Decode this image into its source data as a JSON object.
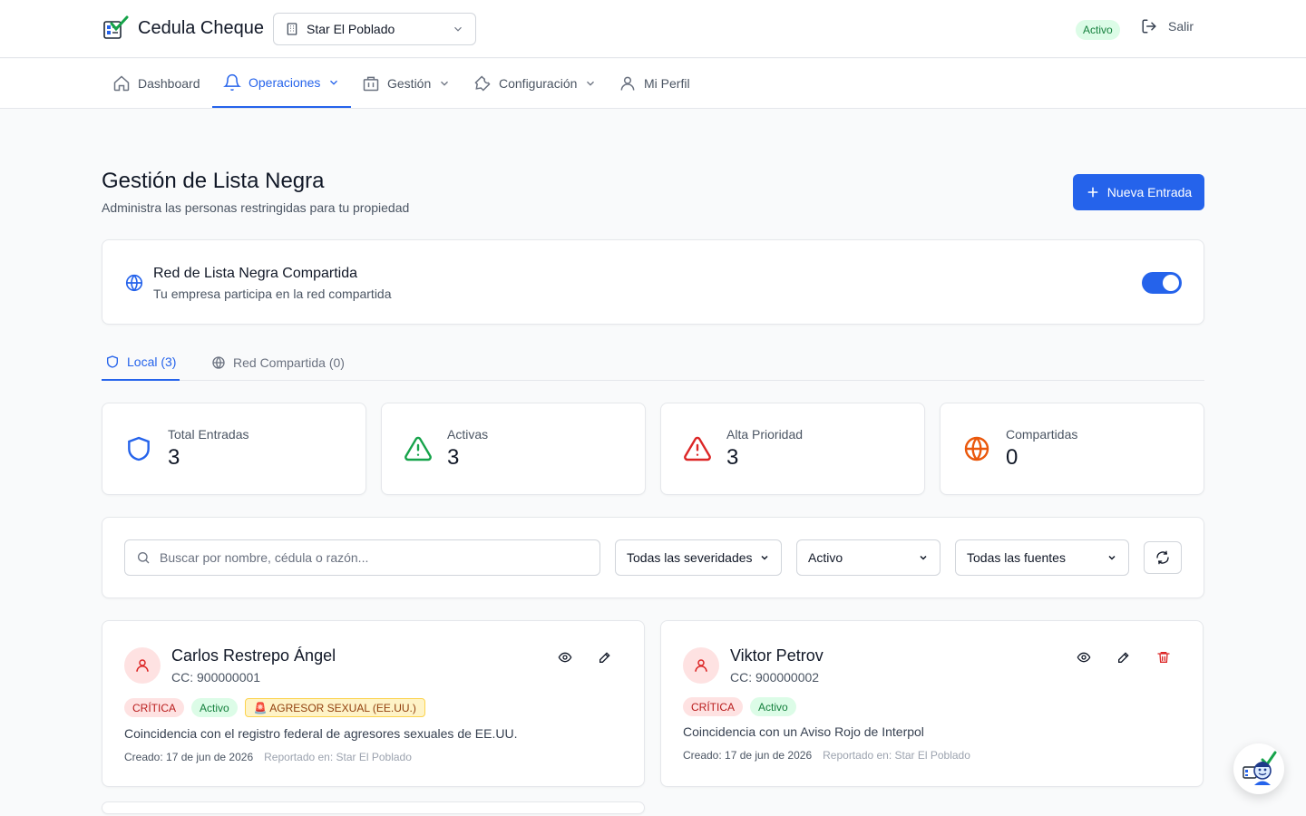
{
  "header": {
    "app_title": "Cedula Cheque",
    "property_selected": "Star El Poblado",
    "status_badge": "Activo",
    "logout_label": "Salir"
  },
  "nav": {
    "items": [
      {
        "label": "Dashboard",
        "icon": "home-icon"
      },
      {
        "label": "Operaciones",
        "icon": "bell-icon"
      },
      {
        "label": "Gestión",
        "icon": "building-icon"
      },
      {
        "label": "Configuración",
        "icon": "wrench-icon"
      },
      {
        "label": "Mi Perfil",
        "icon": "user-icon"
      }
    ],
    "active": "Operaciones"
  },
  "page": {
    "title": "Gestión de Lista Negra",
    "subtitle": "Administra las personas restringidas para tu propiedad",
    "new_button": "Nueva Entrada"
  },
  "shared_network": {
    "title": "Red de Lista Negra Compartida",
    "description": "Tu empresa participa en la red compartida",
    "enabled": true
  },
  "tabs": [
    {
      "label": "Local (3)",
      "icon": "shield-icon"
    },
    {
      "label": "Red Compartida (0)",
      "icon": "globe-icon"
    }
  ],
  "stats": [
    {
      "label": "Total Entradas",
      "value": "3",
      "icon": "shield-icon",
      "color": "#2563eb"
    },
    {
      "label": "Activas",
      "value": "3",
      "icon": "alert-triangle-icon",
      "color": "#16a34a"
    },
    {
      "label": "Alta Prioridad",
      "value": "3",
      "icon": "alert-triangle-icon",
      "color": "#dc2626"
    },
    {
      "label": "Compartidas",
      "value": "0",
      "icon": "globe-icon",
      "color": "#ea580c"
    }
  ],
  "filters": {
    "search_placeholder": "Buscar por nombre, cédula o razón...",
    "severity_selected": "Todas las severidades",
    "status_selected": "Activo",
    "source_selected": "Todas las fuentes"
  },
  "entries": [
    {
      "name": "Carlos Restrepo Ángel",
      "document": "CC: 900000001",
      "badges": [
        "CRÍTICA",
        "Activo"
      ],
      "flag": "🚨 AGRESOR SEXUAL (EE.UU.)",
      "reason": "Coincidencia con el registro federal de agresores sexuales de EE.UU.",
      "created": "Creado: 17 de jun de 2026",
      "reported": "Reportado en: Star El Poblado"
    },
    {
      "name": "Viktor Petrov",
      "document": "CC: 900000002",
      "badges": [
        "CRÍTICA",
        "Activo"
      ],
      "reason": "Coincidencia con un Aviso Rojo de Interpol",
      "created": "Creado: 17 de jun de 2026",
      "reported": "Reportado en: Star El Poblado"
    }
  ],
  "colors": {
    "primary": "#2563eb",
    "danger": "#dc2626",
    "success": "#16a34a",
    "warning": "#ea580c"
  }
}
